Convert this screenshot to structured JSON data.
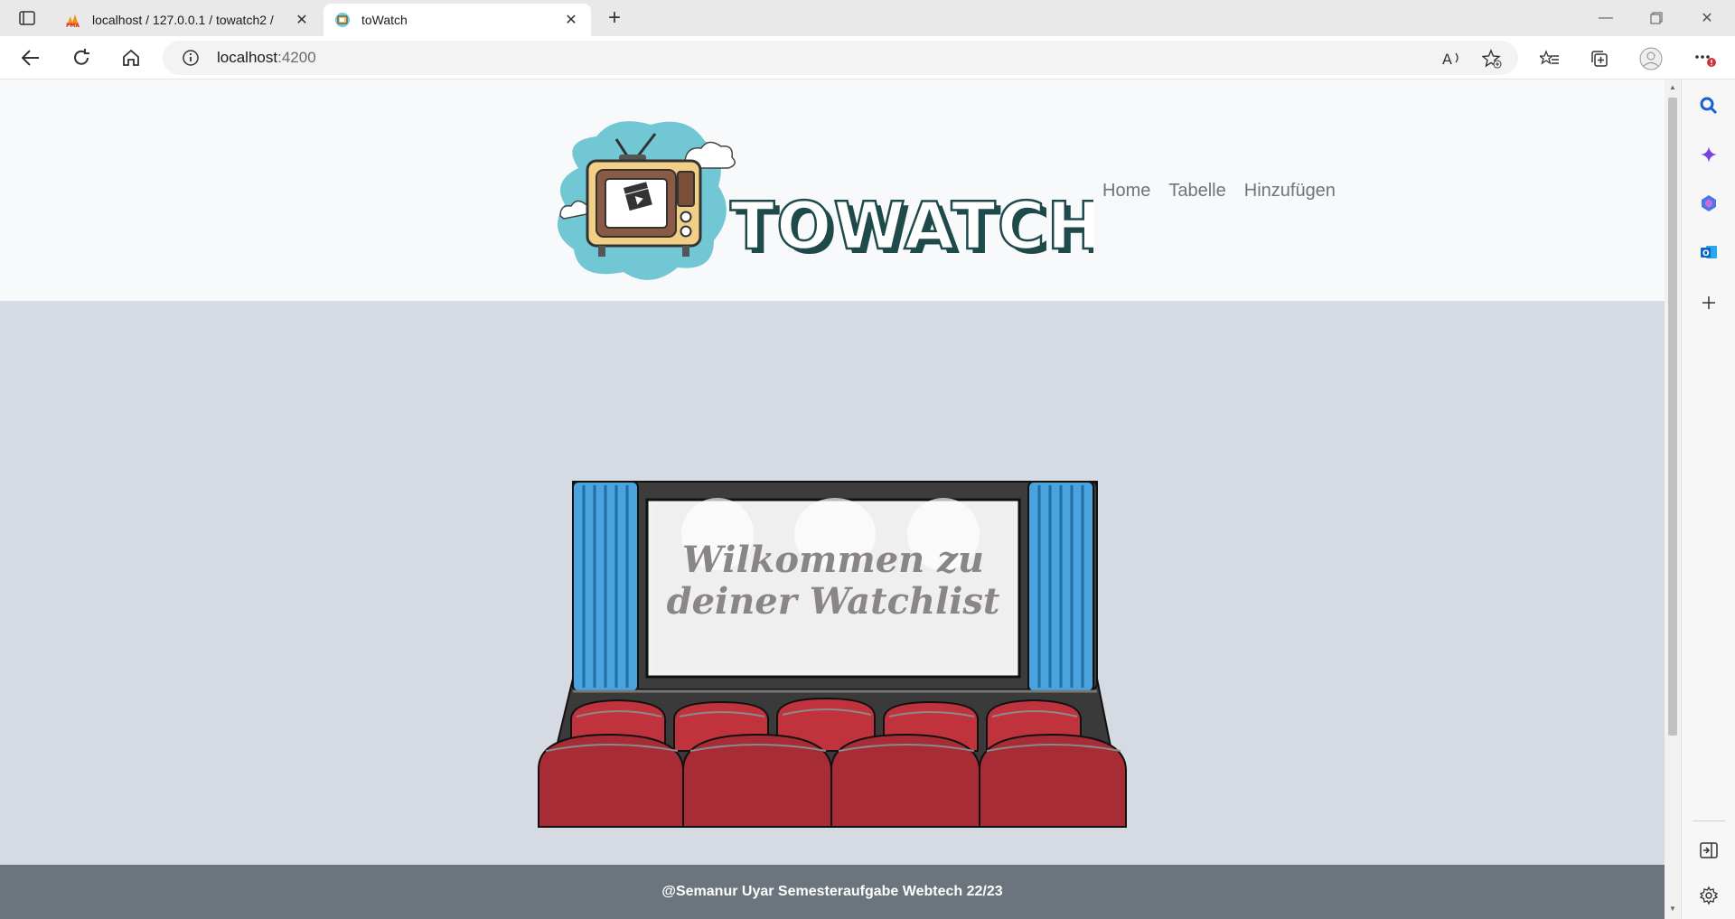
{
  "browser": {
    "tabs": [
      {
        "title": "localhost / 127.0.0.1 / towatch2 /",
        "icon": "phpmyadmin-icon",
        "active": false
      },
      {
        "title": "toWatch",
        "icon": "towatch-favicon-icon",
        "active": true
      }
    ],
    "address": {
      "host": "localhost",
      "port": ":4200"
    }
  },
  "site": {
    "logo_text": "TOWATCH",
    "nav": [
      {
        "label": "Home"
      },
      {
        "label": "Tabelle"
      },
      {
        "label": "Hinzufügen"
      }
    ],
    "hero": {
      "line1": "Wilkommen zu",
      "line2": "deiner Watchlist"
    },
    "footer": "@Semanur Uyar Semesteraufgabe Webtech 22/23"
  },
  "colors": {
    "header_bg": "#f8f9fa",
    "page_bg": "#d6dbe3",
    "footer_bg": "#6c757d",
    "nav_text": "#6c757d",
    "logo_dark": "#1f4a4c",
    "seat_red": "#c0333d",
    "curtain_blue": "#4aa3dc"
  }
}
